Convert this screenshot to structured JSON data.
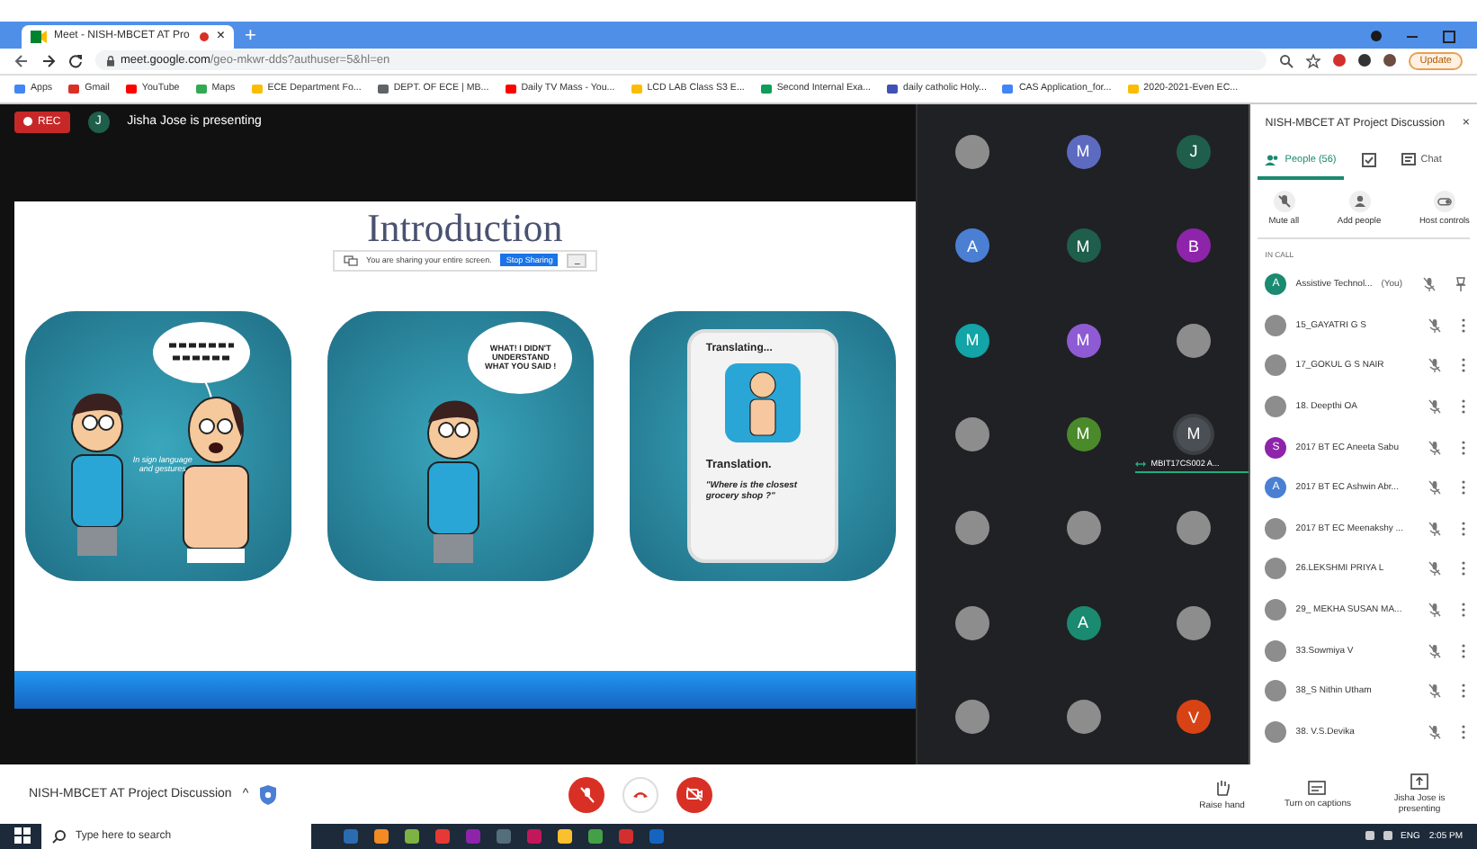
{
  "browser": {
    "tab_title": "Meet - NISH-MBCET AT Pro",
    "tab_close": "×",
    "new_tab": "+",
    "url_host": "meet.google.com",
    "url_path": "/geo-mkwr-dds?authuser=5&hl=en",
    "update_label": "Update",
    "bookmarks": [
      {
        "label": "Apps",
        "color": "#4285f4"
      },
      {
        "label": "Gmail",
        "color": "#d93025"
      },
      {
        "label": "YouTube",
        "color": "#ff0000"
      },
      {
        "label": "Maps",
        "color": "#34a853"
      },
      {
        "label": "ECE Department Fo...",
        "color": "#fbbc04"
      },
      {
        "label": "DEPT. OF ECE | MB...",
        "color": "#5f6368"
      },
      {
        "label": "Daily TV Mass - You...",
        "color": "#ff0000"
      },
      {
        "label": "LCD LAB Class S3 E...",
        "color": "#fbbc04"
      },
      {
        "label": "Second Internal Exa...",
        "color": "#0f9d58"
      },
      {
        "label": "daily catholic Holy...",
        "color": "#3f51b5"
      },
      {
        "label": "CAS Application_for...",
        "color": "#4285f4"
      },
      {
        "label": "2020-2021-Even EC...",
        "color": "#fbbc04"
      }
    ]
  },
  "meet": {
    "rec_label": "REC",
    "presenter_initial": "J",
    "presenting_text": "Jisha Jose is presenting",
    "slide": {
      "title": "Introduction",
      "share_text": "You are sharing your entire screen.",
      "stop_label": "Stop Sharing",
      "hide_label": "_",
      "caption": "In sign language and gestures",
      "bubble_2": "WHAT! I DIDN'T UNDERSTAND WHAT YOU SAID !",
      "translating": "Translating...",
      "translation": "Translation.",
      "quote": "\"Where is the closest grocery shop ?\""
    },
    "tiles": [
      {
        "kind": "photo",
        "speaking": false
      },
      {
        "kind": "letter",
        "letter": "M",
        "color": "#5c6bc0",
        "speaking": false
      },
      {
        "kind": "letter",
        "letter": "J",
        "color": "#1e5e4a",
        "speaking": false
      },
      {
        "kind": "letter",
        "letter": "A",
        "color": "#4a7fd4",
        "speaking": false
      },
      {
        "kind": "letter",
        "letter": "M",
        "color": "#1e5e4a",
        "speaking": false
      },
      {
        "kind": "letter",
        "letter": "B",
        "color": "#8e24aa",
        "speaking": false
      },
      {
        "kind": "letter",
        "letter": "M",
        "color": "#12a4a6",
        "speaking": false
      },
      {
        "kind": "letter",
        "letter": "M",
        "color": "#8e5bd4",
        "speaking": false
      },
      {
        "kind": "photo",
        "speaking": false
      },
      {
        "kind": "photo",
        "speaking": false
      },
      {
        "kind": "letter",
        "letter": "M",
        "color": "#4a8a2a",
        "speaking": false
      },
      {
        "kind": "letter",
        "letter": "M",
        "color": "#4a4f55",
        "speaking": true,
        "label": "MBIT17CS002 A..."
      },
      {
        "kind": "photo",
        "speaking": false
      },
      {
        "kind": "photo",
        "speaking": false
      },
      {
        "kind": "photo",
        "speaking": false
      },
      {
        "kind": "photo",
        "speaking": false
      },
      {
        "kind": "letter",
        "letter": "A",
        "color": "#1a8a70",
        "speaking": false
      },
      {
        "kind": "photo",
        "speaking": false
      },
      {
        "kind": "photo",
        "speaking": false
      },
      {
        "kind": "photo",
        "speaking": false
      },
      {
        "kind": "letter",
        "letter": "V",
        "color": "#d84315",
        "speaking": false
      }
    ]
  },
  "sidebar": {
    "title": "NISH-MBCET AT Project Discussion",
    "close": "×",
    "tabs": [
      {
        "kind": "people",
        "label": "People (56)",
        "selected": true
      },
      {
        "kind": "activities",
        "selected": false
      },
      {
        "kind": "chat",
        "label": "Chat",
        "selected": false
      }
    ],
    "actions": [
      {
        "kind": "mute",
        "label": "Mute all"
      },
      {
        "kind": "add",
        "label": "Add people"
      },
      {
        "kind": "host",
        "label": "Host controls"
      }
    ],
    "section": "IN CALL",
    "people": [
      {
        "kind": "letter",
        "letter": "A",
        "color": "#1a8a70",
        "name": "Assistive Technol...",
        "you": "(You)",
        "self": true
      },
      {
        "kind": "photo",
        "name": "15_GAYATRI G S",
        "self": false
      },
      {
        "kind": "photo",
        "name": "17_GOKUL G S NAIR",
        "self": false
      },
      {
        "kind": "photo",
        "name": "18. Deepthi OA",
        "self": false
      },
      {
        "kind": "letter",
        "letter": "S",
        "color": "#8e24aa",
        "name": "2017 BT EC Aneeta Sabu",
        "self": false
      },
      {
        "kind": "letter",
        "letter": "A",
        "color": "#4a7fd4",
        "name": "2017 BT EC Ashwin Abr...",
        "self": false
      },
      {
        "kind": "photo",
        "name": "2017 BT EC Meenakshy ...",
        "self": false
      },
      {
        "kind": "photo",
        "name": "26.LEKSHMI PRIYA L",
        "self": false
      },
      {
        "kind": "photo",
        "name": "29_ MEKHA SUSAN MA...",
        "self": false
      },
      {
        "kind": "photo",
        "name": "33.Sowmiya V",
        "self": false
      },
      {
        "kind": "photo",
        "name": "38_S Nithin Utham",
        "self": false
      },
      {
        "kind": "photo",
        "name": "38. V.S.Devika",
        "self": false
      }
    ]
  },
  "bottom": {
    "meeting_name": "NISH-MBCET AT Project Discussion",
    "caret": "^",
    "raise_hand": "Raise hand",
    "captions": "Turn on captions",
    "presenting": "Jisha Jose is presenting"
  },
  "taskbar": {
    "search_placeholder": "Type here to search",
    "lang": "ENG",
    "time": "2:05 PM"
  }
}
